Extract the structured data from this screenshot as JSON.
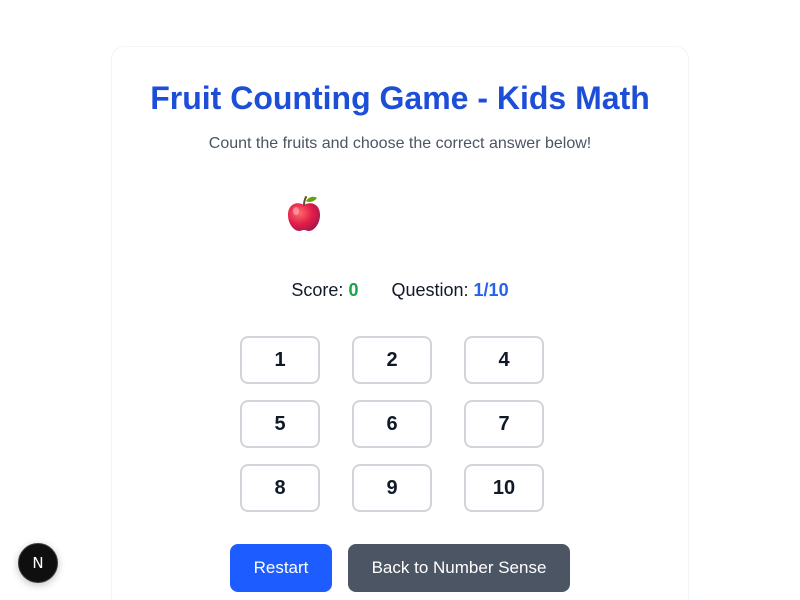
{
  "game": {
    "title": "Fruit Counting Game - Kids Math",
    "subtitle": "Count the fruits and choose the correct answer below!",
    "fruits": [
      {
        "icon": "apple-icon",
        "color": "#e11d48"
      }
    ]
  },
  "stats": {
    "score_label": "Score:",
    "score_value": "0",
    "question_label": "Question:",
    "question_value": "1/10"
  },
  "answers": [
    "1",
    "2",
    "4",
    "5",
    "6",
    "7",
    "8",
    "9",
    "10"
  ],
  "actions": {
    "restart_label": "Restart",
    "back_label": "Back to Number Sense"
  },
  "badge": {
    "letter": "N"
  },
  "colors": {
    "title": "#1d4ed8",
    "score": "#16a34a",
    "question": "#2563eb",
    "primary_button": "#1d5cff",
    "secondary_button": "#4b5563"
  }
}
